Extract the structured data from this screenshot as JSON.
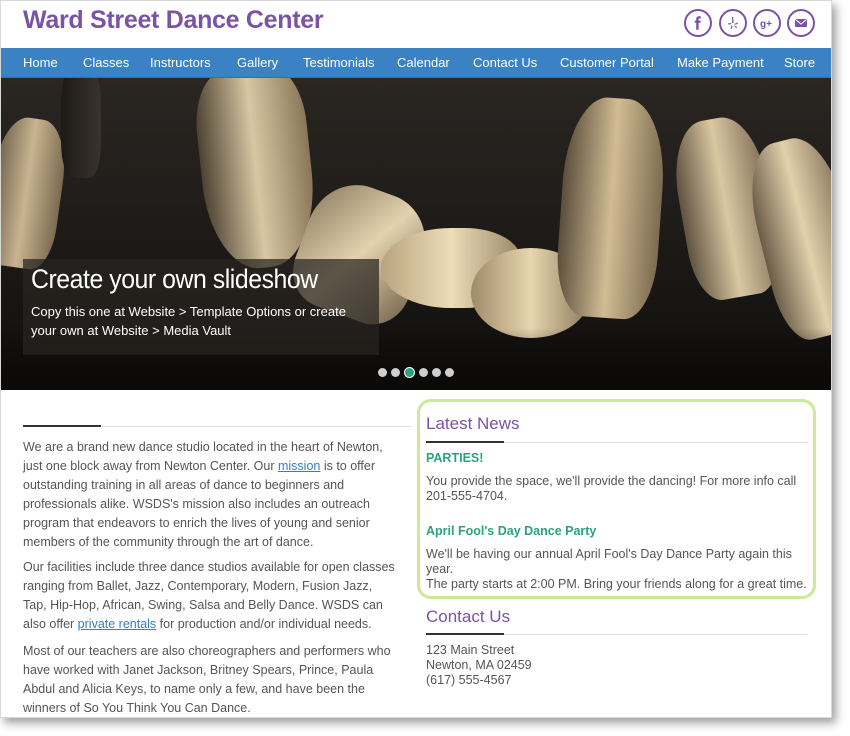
{
  "site": {
    "title": "Ward Street Dance Center"
  },
  "social": [
    {
      "name": "facebook",
      "glyph": "f"
    },
    {
      "name": "yelp",
      "glyph": "y"
    },
    {
      "name": "google-plus",
      "glyph": "g+"
    },
    {
      "name": "email",
      "glyph": "mail"
    }
  ],
  "nav": [
    "Home",
    "Classes",
    "Instructors",
    "Gallery",
    "Testimonials",
    "Calendar",
    "Contact Us",
    "Customer Portal",
    "Make Payment",
    "Store"
  ],
  "hero": {
    "title": "Create your own slideshow",
    "text": "Copy this one at Website > Template Options or create your own at Website > Media Vault",
    "dots": 6,
    "active_dot": 2
  },
  "intro": {
    "p1_before": "We are a brand new dance studio located in the heart of Newton, just one block away from Newton Center.  Our ",
    "p1_link": "mission",
    "p1_after": " is to offer outstanding training in all areas of dance to beginners and professionals alike.  WSDS's mission also includes an outreach program that endeavors to enrich the lives of young and senior members of the community through the art of dance.",
    "p2_before": "Our facilities include three dance studios available for open classes ranging from Ballet, Jazz, Contemporary, Modern, Fusion Jazz, Tap, Hip-Hop, African, Swing, Salsa and Belly Dance. WSDS can also offer ",
    "p2_link": "private rentals",
    "p2_after": " for production and/or individual needs.",
    "p3": "Most of our teachers are also choreographers and performers who have worked with Janet Jackson, Britney Spears, Prince, Paula Abdul and Alicia Keys, to name only a few, and have been the winners of So You Think You Can Dance."
  },
  "news": {
    "title": "Latest News",
    "items": [
      {
        "headline": "PARTIES!",
        "body": "You provide the space, we'll provide the dancing! For more info call 201-555-4704."
      },
      {
        "headline": "April Fool's Day Dance Party",
        "body": "We'll be having our annual April Fool's Day Dance Party again this year.",
        "body2": "The party starts at 2:00 PM. Bring your friends along for a great time."
      }
    ]
  },
  "contact": {
    "title": "Contact Us",
    "street": "123 Main Street",
    "city": "Newton, MA 02459",
    "phone": "(617)  555-4567"
  },
  "colors": {
    "brand_purple": "#7b53a6",
    "nav_blue": "#3a82c4",
    "news_green": "#2aa37e",
    "box_border": "#cde99a"
  }
}
